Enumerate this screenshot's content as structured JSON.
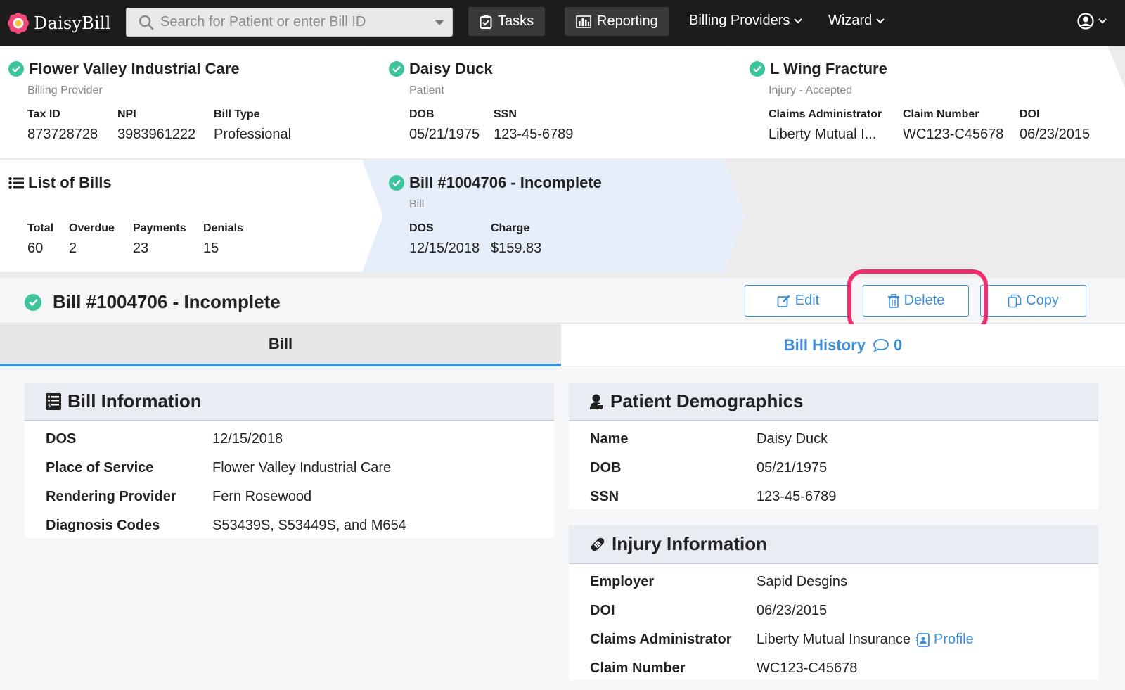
{
  "nav": {
    "brand": "DaisyBill",
    "search_placeholder": "Search for Patient or enter Bill ID",
    "tasks": "Tasks",
    "reporting": "Reporting",
    "billing_providers": "Billing Providers",
    "wizard": "Wizard"
  },
  "crumbs": {
    "provider": {
      "title": "Flower Valley Industrial Care",
      "subtitle": "Billing Provider",
      "fields": [
        {
          "label": "Tax ID",
          "value": "873728728"
        },
        {
          "label": "NPI",
          "value": "3983961222"
        },
        {
          "label": "Bill Type",
          "value": "Professional"
        }
      ]
    },
    "patient": {
      "title": "Daisy Duck",
      "subtitle": "Patient",
      "fields": [
        {
          "label": "DOB",
          "value": "05/21/1975"
        },
        {
          "label": "SSN",
          "value": "123-45-6789"
        }
      ]
    },
    "injury": {
      "title": "L Wing Fracture",
      "subtitle": "Injury - Accepted",
      "fields": [
        {
          "label": "Claims Administrator",
          "value": "Liberty Mutual I..."
        },
        {
          "label": "Claim Number",
          "value": "WC123-C45678"
        },
        {
          "label": "DOI",
          "value": "06/23/2015"
        }
      ]
    },
    "bills": {
      "title": "List of Bills",
      "fields": [
        {
          "label": "Total",
          "value": "60"
        },
        {
          "label": "Overdue",
          "value": "2"
        },
        {
          "label": "Payments",
          "value": "23"
        },
        {
          "label": "Denials",
          "value": "15"
        }
      ]
    },
    "bill": {
      "title": "Bill #1004706 - Incomplete",
      "subtitle": "Bill",
      "fields": [
        {
          "label": "DOS",
          "value": "12/15/2018"
        },
        {
          "label": "Charge",
          "value": "$159.83"
        }
      ]
    }
  },
  "bill_header": {
    "title": "Bill #1004706 - Incomplete",
    "edit": "Edit",
    "delete": "Delete",
    "copy": "Copy"
  },
  "tabs": {
    "bill": "Bill",
    "history": "Bill History",
    "history_count": "0"
  },
  "bill_info": {
    "title": "Bill Information",
    "rows": [
      {
        "label": "DOS",
        "value": "12/15/2018"
      },
      {
        "label": "Place of Service",
        "value": "Flower Valley Industrial Care"
      },
      {
        "label": "Rendering Provider",
        "value": "Fern Rosewood"
      },
      {
        "label": "Diagnosis Codes",
        "value": "S53439S, S53449S, and M654"
      }
    ]
  },
  "patient_demo": {
    "title": "Patient Demographics",
    "rows": [
      {
        "label": "Name",
        "value": "Daisy Duck"
      },
      {
        "label": "DOB",
        "value": "05/21/1975"
      },
      {
        "label": "SSN",
        "value": "123-45-6789"
      }
    ]
  },
  "injury_info": {
    "title": "Injury Information",
    "rows": [
      {
        "label": "Employer",
        "value": "Sapid Desgins"
      },
      {
        "label": "DOI",
        "value": "06/23/2015"
      },
      {
        "label": "Claims Administrator",
        "value": "Liberty Mutual Insurance"
      },
      {
        "label": "Claim Number",
        "value": "WC123-C45678"
      }
    ],
    "profile_link": "Profile"
  },
  "colors": {
    "accent": "#3d8ed6",
    "success": "#3cc49a",
    "highlight": "#ef2e6f",
    "navbar": "#1c1c1c"
  }
}
